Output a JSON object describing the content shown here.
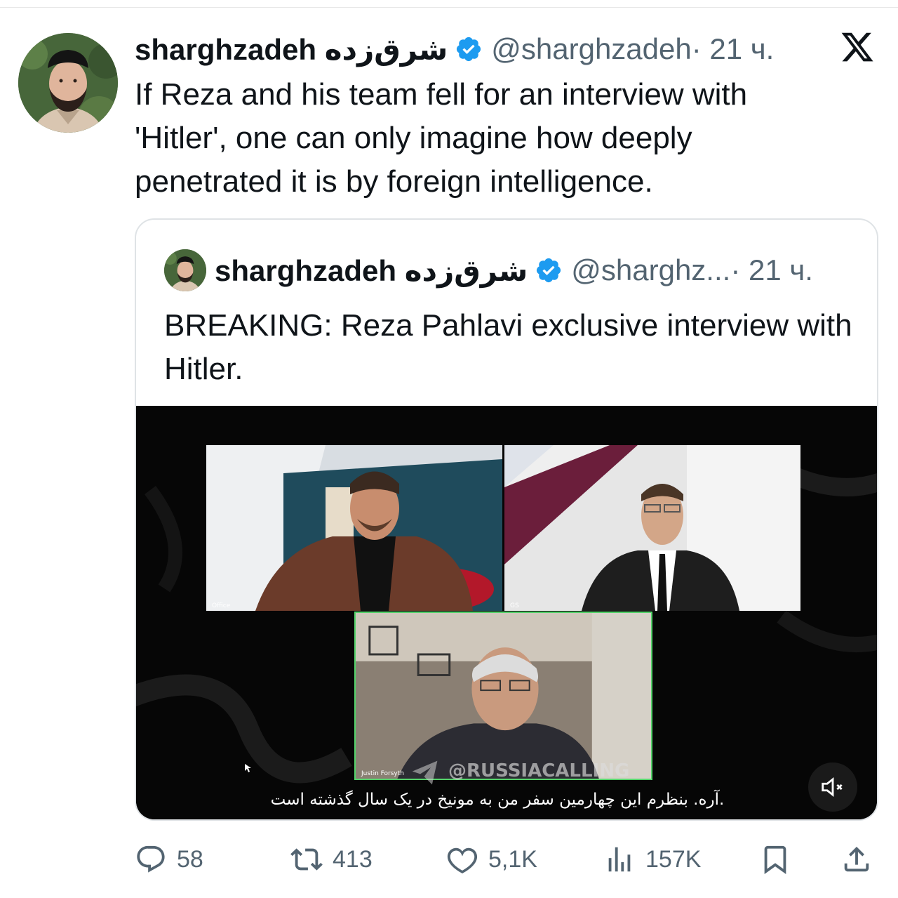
{
  "tweet": {
    "display_name": "sharghzadeh شرق‌زده",
    "handle": "@sharghzadeh",
    "time": "· 21 ч.",
    "text": "If Reza and his team fell for an interview with 'Hitler', one can only imagine how deeply penetrated it is by foreign intelligence."
  },
  "quote": {
    "display_name": "sharghzadeh شرق‌زده",
    "handle": "@sharghz...",
    "time": "· 21 ч.",
    "text": "BREAKING: Reza Pahlavi exclusive interview with Hitler.",
    "video": {
      "tile_labels": [
        "Office",
        "GS",
        "Justin Forsyth"
      ],
      "watermark": "@RUSSIACALLING",
      "subtitle": ".آره. بنظرم این چهارمین سفر من به مونیخ در یک سال گذشته است"
    }
  },
  "stats": {
    "replies": "58",
    "reposts": "413",
    "likes": "5,1K",
    "views": "157K"
  },
  "colors": {
    "verified": "#1d9bf0",
    "secondary_text": "#536471",
    "active_tile_border": "#55d36b"
  },
  "icons": [
    "x-logo-icon",
    "verified-badge-icon",
    "reply-icon",
    "repost-icon",
    "like-icon",
    "views-icon",
    "bookmark-icon",
    "share-icon",
    "mute-icon"
  ]
}
